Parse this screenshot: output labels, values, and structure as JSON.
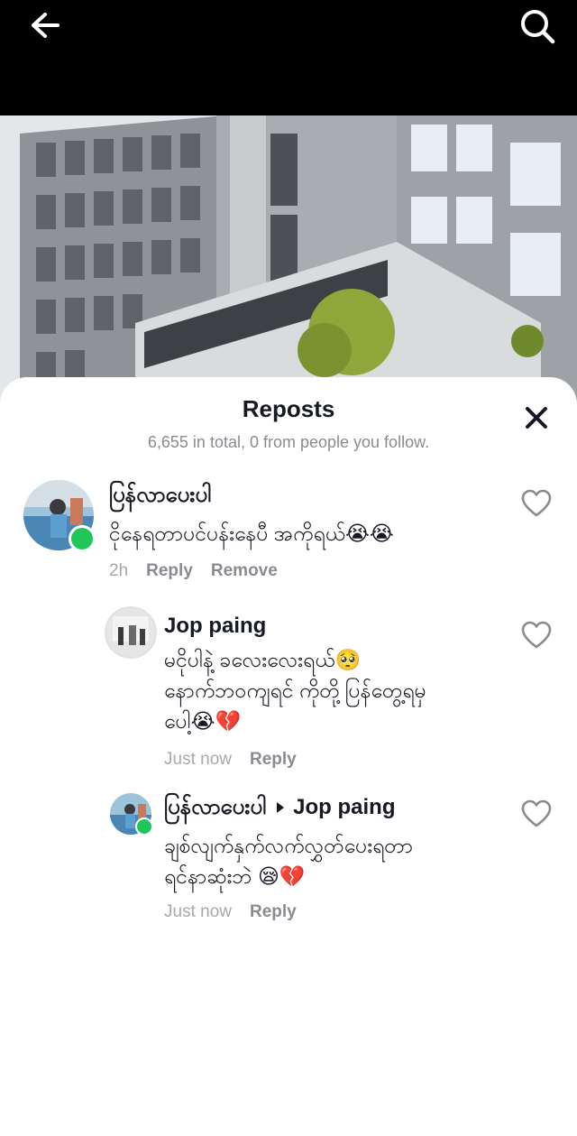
{
  "nav": {
    "back_icon": "arrow-left-icon",
    "search_icon": "search-icon"
  },
  "sheet": {
    "title": "Reposts",
    "subtitle": "6,655 in total, 0 from people you follow.",
    "close_icon": "close-icon"
  },
  "comments": [
    {
      "username": "ပြန်လာပေးပါ",
      "text": "ငိုနေရတာပင်ပန်းနေပီ အကိုရယ်😭😭",
      "time": "2h",
      "reply_label": "Reply",
      "remove_label": "Remove",
      "online": true
    },
    {
      "username": "Jop paing",
      "text_line1": "မငိုပါနဲ့ ခလေးလေးရယ်🥺",
      "text_line2": "နောက်ဘဝကျရင် ကိုတို့ပြန်တွေ့ရမှ",
      "text_line3": "ပေါ့😭💔",
      "time": "Just now",
      "reply_label": "Reply"
    },
    {
      "username": "ပြန်လာပေးပါ",
      "reply_to": "Jop paing",
      "text_line1": "ချစ်လျက်နှက်လက်လွှတ်ပေးရတာ",
      "text_line2": "ရင်နာဆုံးဘဲ 😪💔",
      "time": "Just now",
      "reply_label": "Reply",
      "online": true
    }
  ],
  "colors": {
    "online": "#21c65a",
    "text_primary": "#161823",
    "text_secondary": "#8a8b91"
  }
}
